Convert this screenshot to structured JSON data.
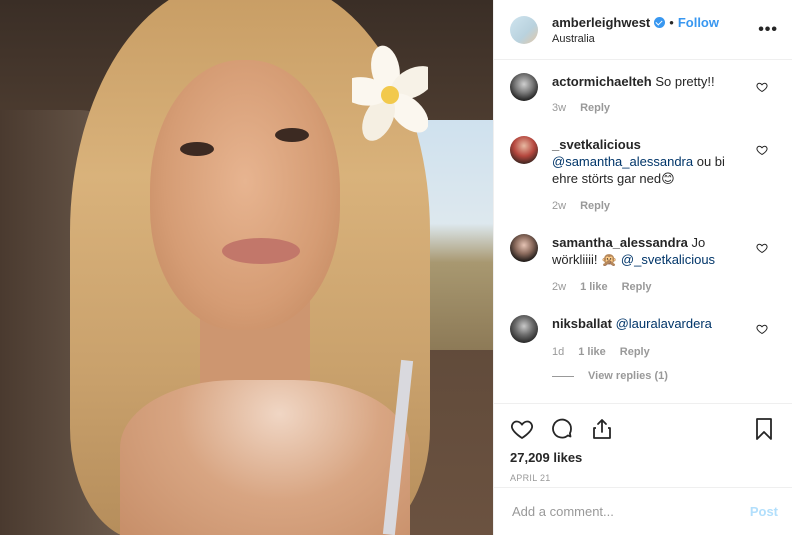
{
  "photo": {
    "description_icon": "selfie-photo"
  },
  "header": {
    "username": "amberleighwest",
    "separator": "•",
    "follow_label": "Follow",
    "location": "Australia",
    "more_icon": "more-options-icon",
    "more_label": "•••"
  },
  "comments": [
    {
      "user": "actormichaelteh",
      "text": "So pretty!!",
      "time": "3w",
      "likes": "",
      "reply": "Reply"
    },
    {
      "user": "_svetkalicious",
      "mention": "@samantha_alessandra",
      "text": " ou bi ehre störts gar ned😊",
      "time": "2w",
      "likes": "",
      "reply": "Reply"
    },
    {
      "user": "samantha_alessandra",
      "text_pre": "Jo wörkliiii! 🙊 ",
      "mention": "@_svetkalicious",
      "time": "2w",
      "likes": "1 like",
      "reply": "Reply"
    },
    {
      "user": "niksballat",
      "mention": "@lauralavardera",
      "time": "1d",
      "likes": "1 like",
      "reply": "Reply",
      "view_replies": "View replies (1)"
    }
  ],
  "actions": {
    "likes": "27,209 likes",
    "date": "APRIL 21"
  },
  "add_comment": {
    "placeholder": "Add a comment...",
    "post_label": "Post"
  },
  "colors": {
    "link": "#3897f0",
    "mention": "#003569",
    "muted": "#999999",
    "post_disabled": "#b2dffc"
  }
}
